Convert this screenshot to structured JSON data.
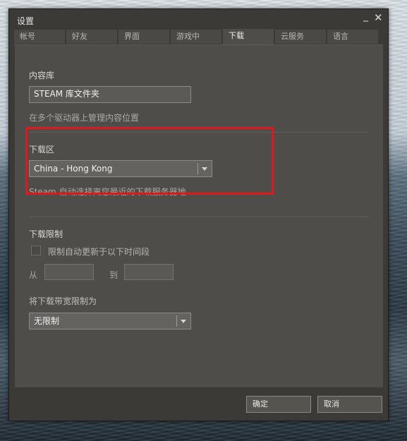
{
  "window": {
    "title": "设置"
  },
  "titlebar_icons": {
    "minimize": "minimize-icon",
    "close": "close-icon"
  },
  "tabs": [
    {
      "label": "帐号"
    },
    {
      "label": "好友"
    },
    {
      "label": "界面"
    },
    {
      "label": "游戏中"
    },
    {
      "label": "下载",
      "active": true
    },
    {
      "label": "云服务"
    },
    {
      "label": "语言"
    }
  ],
  "content_library": {
    "heading": "内容库",
    "button_label": "STEAM 库文件夹",
    "description": "在多个驱动器上管理内容位置"
  },
  "download_region": {
    "heading": "下载区",
    "selected": "China - Hong Kong",
    "description": "Steam 自动选择离您最近的下载服务器地..."
  },
  "download_restrictions": {
    "heading": "下载限制",
    "checkbox_label": "限制自动更新于以下时间段",
    "checked": false,
    "from_label": "从",
    "to_label": "到",
    "from_value": "",
    "to_value": ""
  },
  "bandwidth": {
    "heading": "将下载带宽限制为",
    "selected": "无限制"
  },
  "footer": {
    "ok_label": "确定",
    "cancel_label": "取消"
  },
  "colors": {
    "highlight_border": "#e0171d",
    "window_bg": "#3b3a37",
    "panel_bg": "#4e4d49"
  }
}
